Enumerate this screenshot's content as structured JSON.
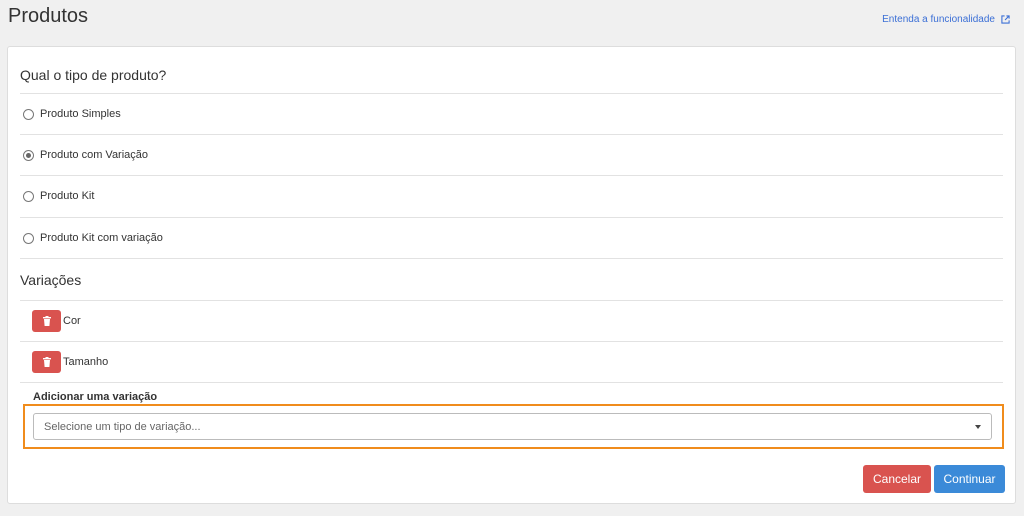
{
  "header": {
    "title": "Produtos",
    "help_link": "Entenda a funcionalidade"
  },
  "product_type": {
    "title": "Qual o tipo de produto?",
    "options": [
      {
        "label": "Produto Simples",
        "checked": false
      },
      {
        "label": "Produto com Variação",
        "checked": true
      },
      {
        "label": "Produto Kit",
        "checked": false
      },
      {
        "label": "Produto Kit com variação",
        "checked": false
      }
    ]
  },
  "variations": {
    "title": "Variações",
    "items": [
      {
        "label": "Cor"
      },
      {
        "label": "Tamanho"
      }
    ],
    "add_label": "Adicionar uma variação",
    "select_placeholder": "Selecione um tipo de variação..."
  },
  "actions": {
    "cancel_label": "Cancelar",
    "continue_label": "Continuar"
  },
  "colors": {
    "danger": "#d9534f",
    "primary": "#3b8ad8",
    "highlight": "#f08c1c",
    "link": "#3b6fd6"
  }
}
